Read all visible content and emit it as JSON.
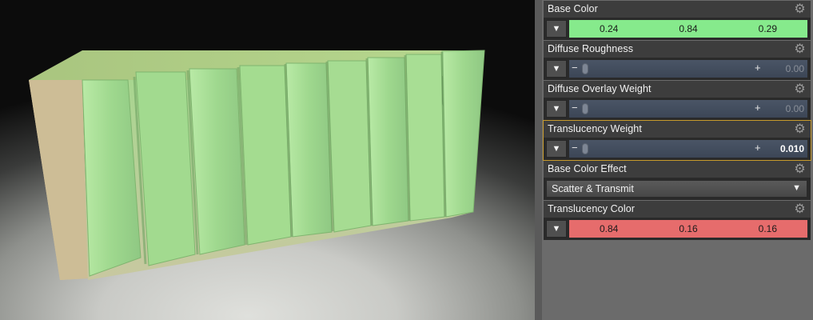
{
  "properties": [
    {
      "name": "Base Color",
      "kind": "color",
      "values": [
        "0.24",
        "0.84",
        "0.29"
      ],
      "color": "#86ea8c"
    },
    {
      "name": "Diffuse Roughness",
      "kind": "slider",
      "value": "0.00"
    },
    {
      "name": "Diffuse Overlay Weight",
      "kind": "slider",
      "value": "0.00"
    },
    {
      "name": "Translucency Weight",
      "kind": "slider",
      "value": "0.010",
      "selected": true
    },
    {
      "name": "Base Color Effect",
      "kind": "combo",
      "value": "Scatter & Transmit"
    },
    {
      "name": "Translucency Color",
      "kind": "color",
      "values": [
        "0.84",
        "0.16",
        "0.16"
      ],
      "color": "#e66c6c"
    }
  ],
  "icons": {
    "gear": "gear-icon",
    "dropdown": "triangle-down-icon"
  },
  "colors": {
    "selection_outline": "#c79a2c",
    "object_green": "#8fd28e"
  }
}
